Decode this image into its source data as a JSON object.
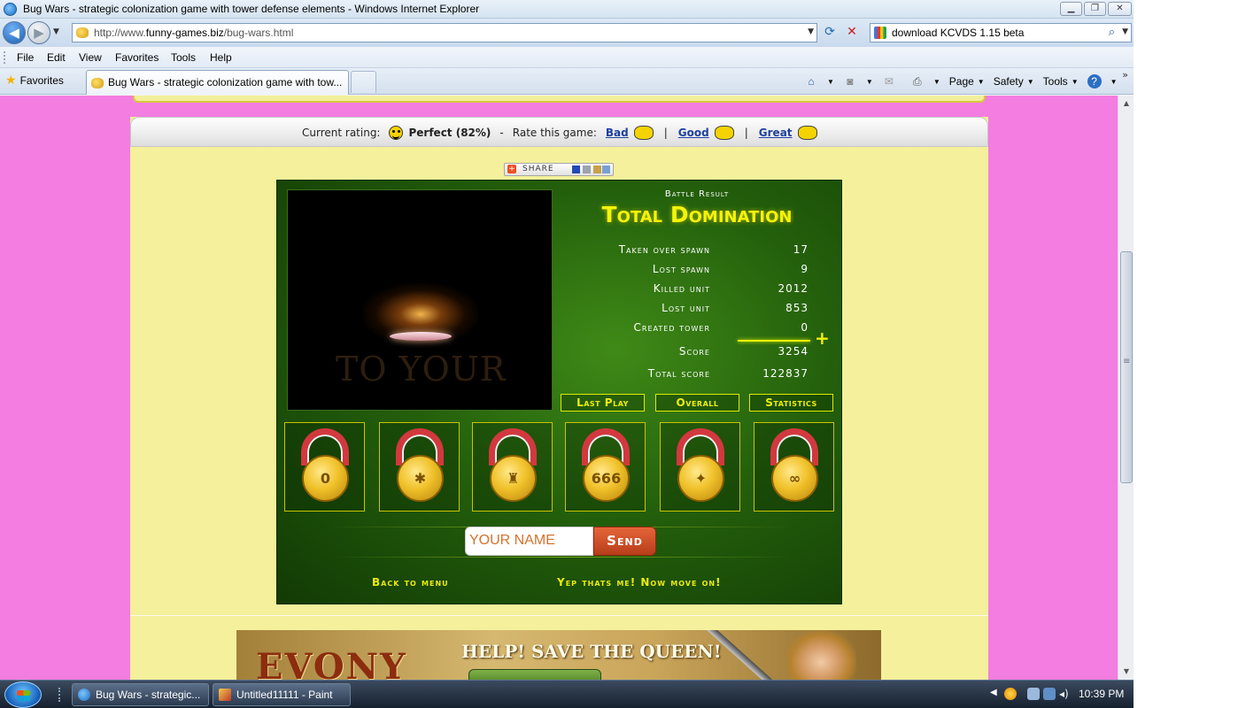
{
  "window": {
    "title": "Bug Wars - strategic colonization game with tower defense elements - Windows Internet Explorer",
    "min": "▁",
    "max": "❐",
    "close": "✕"
  },
  "address": {
    "url_prefix": "http://www.",
    "url_domain": "funny-games.biz",
    "url_path": "/bug-wars.html",
    "search_text": "download KCVDS 1.15 beta"
  },
  "menu": [
    "File",
    "Edit",
    "View",
    "Favorites",
    "Tools",
    "Help"
  ],
  "tabbar": {
    "favorites_label": "Favorites",
    "tab_label": "Bug Wars - strategic colonization game with tow...",
    "commands": [
      "Page",
      "Safety",
      "Tools"
    ]
  },
  "rating": {
    "current_label": "Current rating:",
    "current_value": "Perfect (82%)",
    "dash": "-",
    "rate_label": "Rate this game:",
    "bad": "Bad",
    "good": "Good",
    "great": "Great",
    "sep": "|"
  },
  "share": {
    "label": "SHARE"
  },
  "game": {
    "preview_ghost_text": "TO YOUR",
    "battle_result_label": "Battle Result",
    "result_title": "Total Domination",
    "stats": [
      {
        "label": "Taken over spawn",
        "value": "17"
      },
      {
        "label": "Lost spawn",
        "value": "9"
      },
      {
        "label": "Killed unit",
        "value": "2012"
      },
      {
        "label": "Lost unit",
        "value": "853"
      },
      {
        "label": "Created tower",
        "value": "0"
      },
      {
        "label": "Score",
        "value": "3254"
      },
      {
        "label": "Total score",
        "value": "122837"
      }
    ],
    "buttons": {
      "last_play": "Last Play",
      "overall": "Overall",
      "statistics": "Statistics"
    },
    "medals": [
      "0",
      "✱",
      "♜",
      "666",
      "✦",
      "∞"
    ],
    "name_placeholder": "YOUR NAME",
    "send": "Send",
    "back_to_menu": "Back to menu",
    "move_on": "Yep thats me! Now move on!"
  },
  "ad": {
    "brand": "EVONY",
    "headline": "HELP! SAVE THE QUEEN!"
  },
  "taskbar": {
    "items": [
      "Bug Wars - strategic...",
      "Untitled11111 - Paint"
    ],
    "clock": "10:39 PM"
  },
  "colors": {
    "page_bg": "#f37de0",
    "content_bg": "#f4f09b",
    "game_green": "#24600c",
    "accent_yellow": "#f4f40a",
    "send_orange": "#d2542d"
  }
}
